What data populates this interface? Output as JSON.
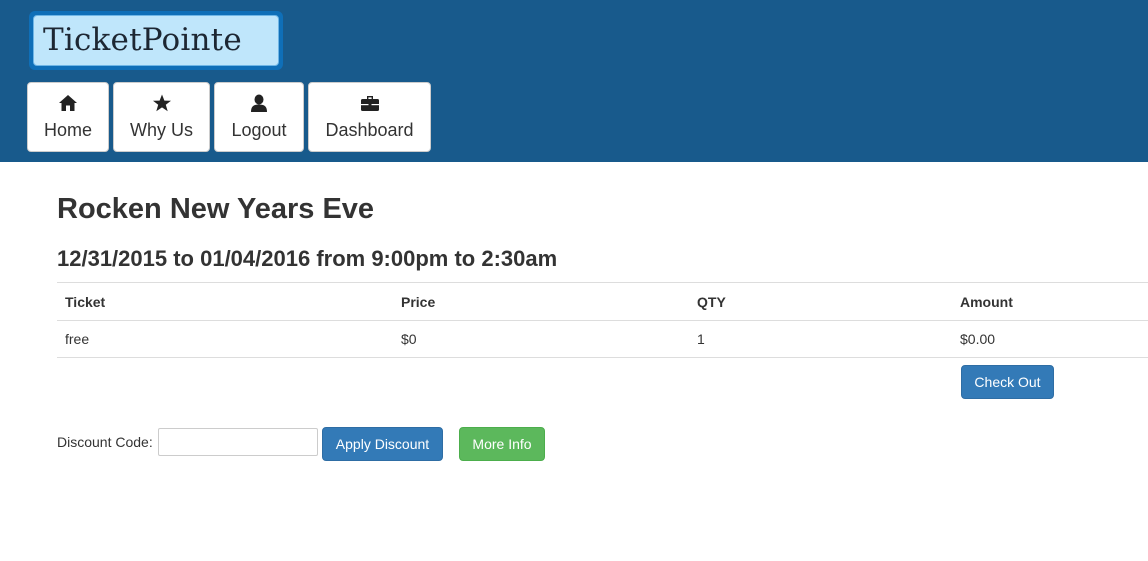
{
  "brand": {
    "logo_text": "TicketPointe"
  },
  "nav": [
    {
      "label": "Home",
      "icon": "home-icon"
    },
    {
      "label": "Why Us",
      "icon": "star-icon"
    },
    {
      "label": "Logout",
      "icon": "user-icon"
    },
    {
      "label": "Dashboard",
      "icon": "briefcase-icon"
    }
  ],
  "event": {
    "title": "Rocken New Years Eve",
    "dates": "12/31/2015 to 01/04/2016 from 9:00pm to 2:30am"
  },
  "table": {
    "headers": [
      "Ticket",
      "Price",
      "QTY",
      "Amount"
    ],
    "rows": [
      [
        "free",
        "$0",
        "1",
        "$0.00"
      ]
    ]
  },
  "actions": {
    "checkout_label": "Check Out",
    "discount_label": "Discount Code:",
    "discount_value": "",
    "apply_discount_label": "Apply Discount",
    "more_info_label": "More Info"
  },
  "colors": {
    "header_bg": "#185a8c",
    "logo_bg": "#bfe6fb",
    "primary": "#337ab7",
    "success": "#5cb85c"
  }
}
